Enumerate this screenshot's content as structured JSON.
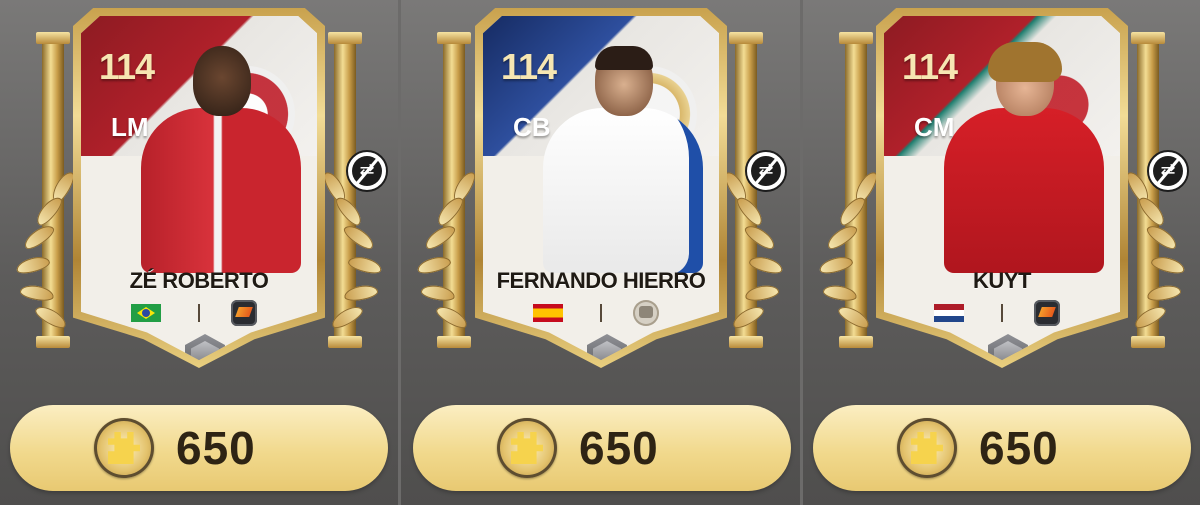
{
  "cards": [
    {
      "rating": "114",
      "position": "LM",
      "name": "ZÉ ROBERTO",
      "flag_colors": [
        "#229e45",
        "#f8e509",
        "#2b49a3"
      ],
      "badge_icon": "club-badge-icon",
      "price": "650",
      "accent": "#b0202a"
    },
    {
      "rating": "114",
      "position": "CB",
      "name": "FERNANDO HIERRO",
      "flag_colors": [
        "#c60b1e",
        "#ffc400",
        "#c60b1e"
      ],
      "badge_icon": "icons-badge-icon",
      "price": "650",
      "accent": "#2e4f9e"
    },
    {
      "rating": "114",
      "position": "CM",
      "name": "KUYT",
      "flag_colors": [
        "#ae1c28",
        "#ffffff",
        "#21468b"
      ],
      "badge_icon": "club-badge-icon",
      "price": "650",
      "accent": "#b0202a"
    }
  ],
  "icons": {
    "untradeable": "untradeable-icon",
    "currency": "puzzle-coin-icon",
    "rarity": "silver-hex-icon"
  }
}
